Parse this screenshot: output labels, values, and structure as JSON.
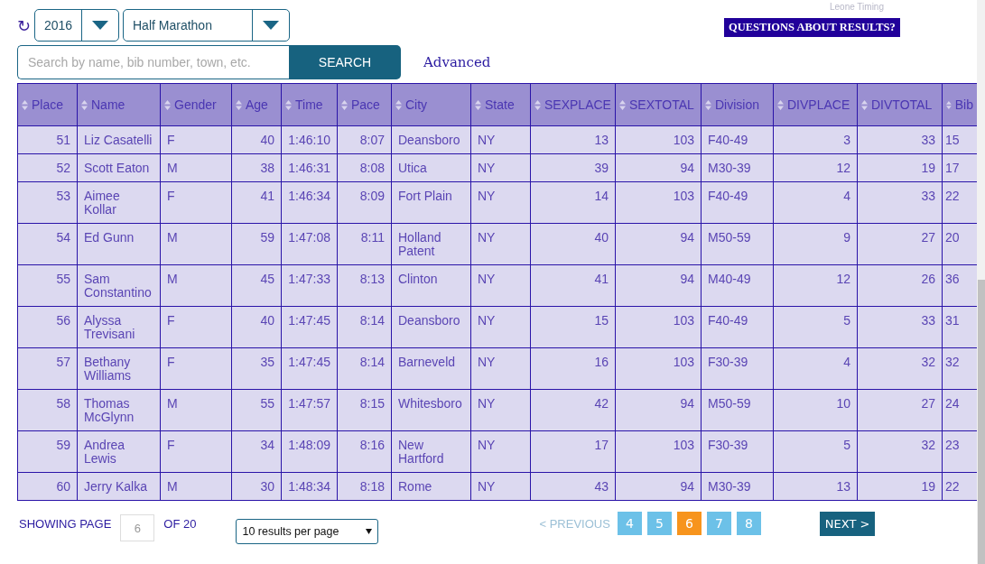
{
  "brand": "Leone Timing",
  "refresh_icon": "↻",
  "filters": [
    {
      "kind": "year",
      "value": "2016"
    },
    {
      "kind": "race",
      "value": "Half Marathon"
    }
  ],
  "questions_button": "QUESTIONS ABOUT RESULTS?",
  "search": {
    "placeholder": "Search by name, bib number, town, etc.",
    "button": "SEARCH",
    "advanced_link": "Advanced"
  },
  "table": {
    "columns": [
      "Place",
      "Name",
      "Gender",
      "Age",
      "Time",
      "Pace",
      "City",
      "State",
      "SEXPLACE",
      "SEXTOTAL",
      "Division",
      "DIVPLACE",
      "DIVTOTAL",
      "Bib"
    ],
    "rows": [
      [
        "51",
        "Liz Casatelli",
        "F",
        "40",
        "1:46:10",
        "8:07",
        "Deansboro",
        "NY",
        "13",
        "103",
        "F40-49",
        "3",
        "33",
        "15"
      ],
      [
        "52",
        "Scott Eaton",
        "M",
        "38",
        "1:46:31",
        "8:08",
        "Utica",
        "NY",
        "39",
        "94",
        "M30-39",
        "12",
        "19",
        "17"
      ],
      [
        "53",
        "Aimee Kollar",
        "F",
        "41",
        "1:46:34",
        "8:09",
        "Fort Plain",
        "NY",
        "14",
        "103",
        "F40-49",
        "4",
        "33",
        "22"
      ],
      [
        "54",
        "Ed Gunn",
        "M",
        "59",
        "1:47:08",
        "8:11",
        "Holland Patent",
        "NY",
        "40",
        "94",
        "M50-59",
        "9",
        "27",
        "20"
      ],
      [
        "55",
        "Sam Constantino",
        "M",
        "45",
        "1:47:33",
        "8:13",
        "Clinton",
        "NY",
        "41",
        "94",
        "M40-49",
        "12",
        "26",
        "36"
      ],
      [
        "56",
        "Alyssa Trevisani",
        "F",
        "40",
        "1:47:45",
        "8:14",
        "Deansboro",
        "NY",
        "15",
        "103",
        "F40-49",
        "5",
        "33",
        "31"
      ],
      [
        "57",
        "Bethany Williams",
        "F",
        "35",
        "1:47:45",
        "8:14",
        "Barneveld",
        "NY",
        "16",
        "103",
        "F30-39",
        "4",
        "32",
        "32"
      ],
      [
        "58",
        "Thomas McGlynn",
        "M",
        "55",
        "1:47:57",
        "8:15",
        "Whitesboro",
        "NY",
        "42",
        "94",
        "M50-59",
        "10",
        "27",
        "24"
      ],
      [
        "59",
        "Andrea Lewis",
        "F",
        "34",
        "1:48:09",
        "8:16",
        "New Hartford",
        "NY",
        "17",
        "103",
        "F30-39",
        "5",
        "32",
        "23"
      ],
      [
        "60",
        "Jerry Kalka",
        "M",
        "30",
        "1:48:34",
        "8:18",
        "Rome",
        "NY",
        "43",
        "94",
        "M30-39",
        "13",
        "19",
        "22"
      ]
    ]
  },
  "pagination": {
    "showing_label": "SHOWING PAGE",
    "page_value": "6",
    "of_label": "OF 20",
    "per_page": "10 results per page",
    "previous": {
      "label": "< PREVIOUS",
      "disabled": true
    },
    "pages": [
      {
        "label": "4",
        "selected": false
      },
      {
        "label": "5",
        "selected": false
      },
      {
        "label": "6",
        "selected": true
      },
      {
        "label": "7",
        "selected": false
      },
      {
        "label": "8",
        "selected": false
      }
    ],
    "next": {
      "label": "NEXT >",
      "disabled": false
    }
  }
}
